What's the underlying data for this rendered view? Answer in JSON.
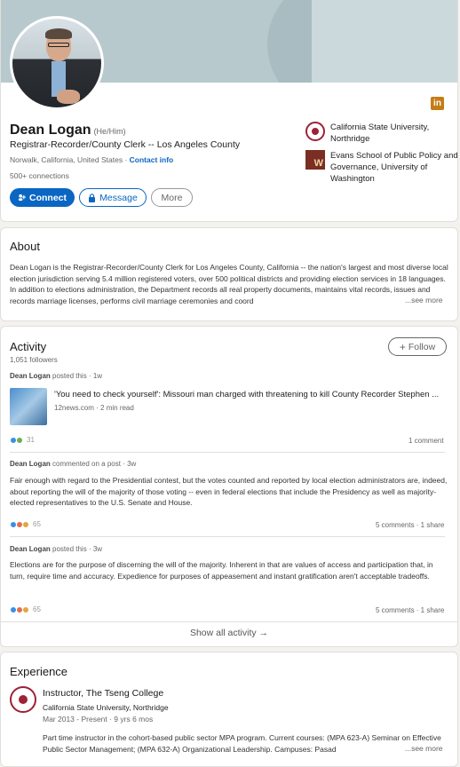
{
  "profile": {
    "name": "Dean Logan",
    "pronouns": "(He/Him)",
    "headline": "Registrar-Recorder/County Clerk -- Los Angeles County",
    "location": "Norwalk, California, United States",
    "location_sep": " · ",
    "contact_info": "Contact info",
    "connections": "500+ connections",
    "connect_label": "Connect",
    "message_label": "Message",
    "more_label": "More",
    "linkedin_badge": "in",
    "education": [
      {
        "name": "California State University, Northridge",
        "logo": "csun-seal-icon"
      },
      {
        "name": "Evans School of Public Policy and Governance, University of Washington",
        "logo": "uw-logo-icon",
        "logo_letter": "W"
      }
    ]
  },
  "about": {
    "title": "About",
    "text": "Dean Logan is the Registrar-Recorder/County Clerk for Los Angeles County, California -- the nation's largest and most diverse local election jurisdiction serving 5.4 million registered voters, over 500 political districts and providing election services in 18 languages. In addition to elections administration, the Department records all real property documents, maintains vital records, issues and records marriage licenses, performs civil marriage ceremonies and coord",
    "see_more": "...see more"
  },
  "activity": {
    "title": "Activity",
    "followers": "1,051 followers",
    "follow_label": "Follow",
    "posts": [
      {
        "author": "Dean Logan",
        "action": "posted this",
        "time": "1w",
        "article_title": "'You need to check yourself': Missouri man charged with threatening to kill County Recorder Stephen ...",
        "article_source": "12news.com",
        "article_read": "2 min read",
        "reactions": "31",
        "stats": "1 comment"
      },
      {
        "author": "Dean Logan",
        "action": "commented on a post",
        "time": "3w",
        "text": "Fair enough with regard to the Presidential contest, but the votes counted and reported by local election administrators are, indeed, about reporting the will of the majority of those voting -- even in federal elections that include the Presidency as well as majority-elected representatives to the U.S. Senate and House.",
        "reactions": "65",
        "stats": "5 comments · 1 share"
      },
      {
        "author": "Dean Logan",
        "action": "posted this",
        "time": "3w",
        "text": "Elections are for the purpose of discerning the will of the majority. Inherent in that are values of access and participation that, in turn, require time and accuracy. Expedience for purposes of appeasement and instant gratification aren't acceptable tradeoffs.",
        "reactions": "65",
        "stats": "5 comments · 1 share"
      }
    ],
    "show_all": "Show all activity →"
  },
  "experience": {
    "title": "Experience",
    "items": [
      {
        "title": "Instructor, The Tseng College",
        "company": "California State University, Northridge",
        "dates": "Mar 2013 - Present · 9 yrs 6 mos",
        "description": "Part time instructor in the cohort-based public sector MPA program. Current courses: (MPA 623-A) Seminar on Effective Public Sector Management; (MPA 632-A) Organizational Leadership. Campuses: Pasad",
        "see_more": "...see more"
      }
    ]
  },
  "colors": {
    "brand_blue": "#0a66c2",
    "csun_red": "#9e2136",
    "uw_purple": "#7b2e23",
    "linkedin_badge_bg": "#c37d16"
  }
}
